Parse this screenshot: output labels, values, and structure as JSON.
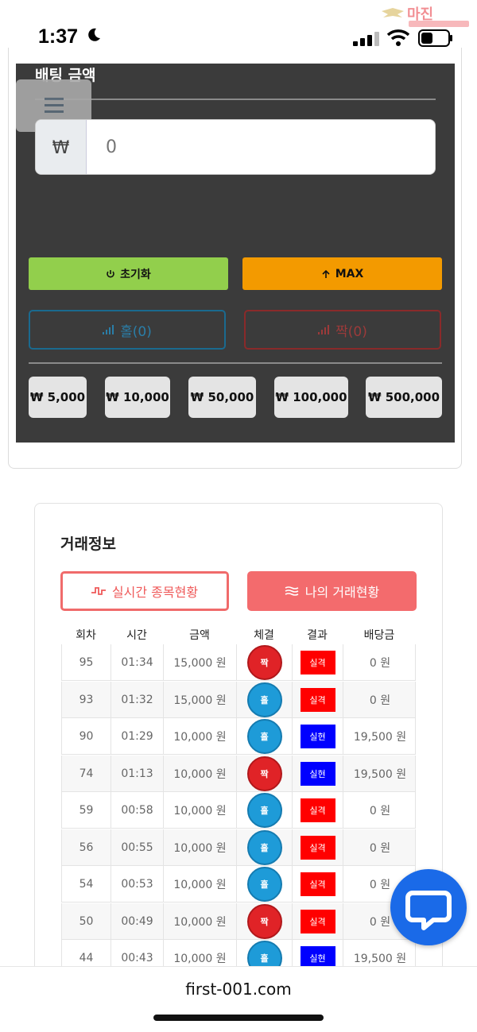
{
  "status_bar": {
    "time": "1:37"
  },
  "watermark": {
    "text": "마진"
  },
  "betting": {
    "title": "배팅 금액",
    "currency_symbol": "₩",
    "amount_placeholder": "0",
    "reset_label": "초기화",
    "max_label": "MAX",
    "odd_label": "홀(0)",
    "even_label": "짝(0)",
    "chips": [
      "₩ 5,000",
      "₩ 10,000",
      "₩ 50,000",
      "₩ 100,000",
      "₩ 500,000"
    ]
  },
  "trade_info": {
    "title": "거래정보",
    "tab_live": "실시간 종목현황",
    "tab_mine": "나의 거래현황",
    "columns": [
      "회차",
      "시간",
      "금액",
      "체결",
      "결과",
      "배당금"
    ],
    "rows": [
      {
        "round": "95",
        "time": "01:34",
        "amount": "15,000 원",
        "pick": "짝",
        "pick_type": "even",
        "result": "실격",
        "result_type": "lose",
        "payout": "0 원"
      },
      {
        "round": "93",
        "time": "01:32",
        "amount": "15,000 원",
        "pick": "홀",
        "pick_type": "odd",
        "result": "실격",
        "result_type": "lose",
        "payout": "0 원"
      },
      {
        "round": "90",
        "time": "01:29",
        "amount": "10,000 원",
        "pick": "홀",
        "pick_type": "odd",
        "result": "실현",
        "result_type": "win",
        "payout": "19,500 원"
      },
      {
        "round": "74",
        "time": "01:13",
        "amount": "10,000 원",
        "pick": "짝",
        "pick_type": "even",
        "result": "실현",
        "result_type": "win",
        "payout": "19,500 원"
      },
      {
        "round": "59",
        "time": "00:58",
        "amount": "10,000 원",
        "pick": "홀",
        "pick_type": "odd",
        "result": "실격",
        "result_type": "lose",
        "payout": "0 원"
      },
      {
        "round": "56",
        "time": "00:55",
        "amount": "10,000 원",
        "pick": "홀",
        "pick_type": "odd",
        "result": "실격",
        "result_type": "lose",
        "payout": "0 원"
      },
      {
        "round": "54",
        "time": "00:53",
        "amount": "10,000 원",
        "pick": "홀",
        "pick_type": "odd",
        "result": "실격",
        "result_type": "lose",
        "payout": "0 원"
      },
      {
        "round": "50",
        "time": "00:49",
        "amount": "10,000 원",
        "pick": "짝",
        "pick_type": "even",
        "result": "실격",
        "result_type": "lose",
        "payout": "0 원"
      },
      {
        "round": "44",
        "time": "00:43",
        "amount": "10,000 원",
        "pick": "홀",
        "pick_type": "odd",
        "result": "실현",
        "result_type": "win",
        "payout": "19,500 원"
      }
    ]
  },
  "colors": {
    "odd": "#1e9bd8",
    "even": "#e02327",
    "lose": "#ff0000",
    "win": "#0000ff",
    "reset": "#92cf4c",
    "max": "#f39a00",
    "accent": "#f36b6d",
    "chat": "#1a6ae8"
  },
  "browser": {
    "url": "first-001.com"
  }
}
